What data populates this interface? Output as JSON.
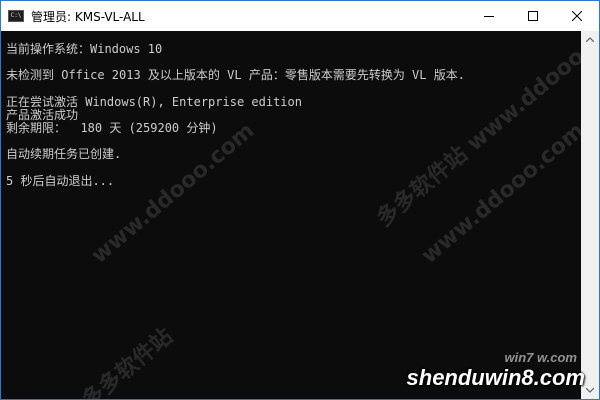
{
  "window": {
    "icon_text": "C:\\",
    "title": "管理员:  KMS-VL-ALL"
  },
  "console": {
    "lines": [
      "当前操作系统：Windows 10",
      "未检测到 Office 2013 及以上版本的 VL 产品：零售版本需要先转换为 VL 版本.",
      "正在尝试激活 Windows(R), Enterprise edition",
      "产品激活成功",
      "剩余期限：  180 天 (259200 分钟)",
      "自动续期任务已创建.",
      "5 秒后自动退出..."
    ]
  },
  "watermarks": {
    "top_right": "多多软件站 www.ddooo.com",
    "center_left": "www.ddooo.com",
    "center_right": "www.ddooo.com",
    "bottom_left": "多多软件站"
  },
  "brand": {
    "logo_small": "win7 w.com",
    "logo_main": "shenduwin8.com"
  }
}
